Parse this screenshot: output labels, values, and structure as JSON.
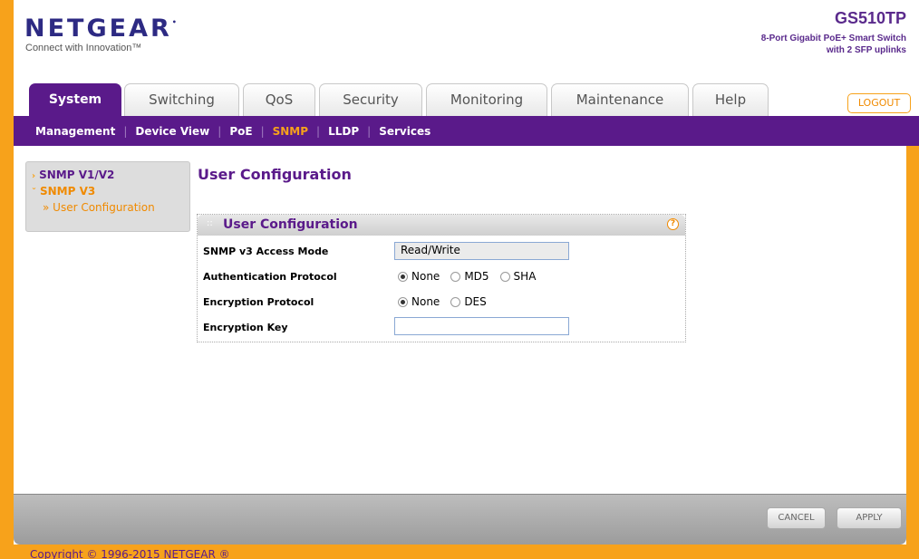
{
  "header": {
    "logo": "NETGEAR",
    "tagline": "Connect with Innovation™",
    "model": "GS510TP",
    "model_desc_line1": "8-Port Gigabit PoE+ Smart Switch",
    "model_desc_line2": "with 2 SFP uplinks",
    "logout_label": "LOGOUT"
  },
  "tabs": [
    {
      "label": "System"
    },
    {
      "label": "Switching"
    },
    {
      "label": "QoS"
    },
    {
      "label": "Security"
    },
    {
      "label": "Monitoring"
    },
    {
      "label": "Maintenance"
    },
    {
      "label": "Help"
    }
  ],
  "subnav": {
    "items": [
      {
        "label": "Management"
      },
      {
        "label": "Device View"
      },
      {
        "label": "PoE"
      },
      {
        "label": "SNMP"
      },
      {
        "label": "LLDP"
      },
      {
        "label": "Services"
      }
    ],
    "active": "SNMP"
  },
  "sidebar": {
    "items": [
      {
        "label": "SNMP V1/V2"
      },
      {
        "label": "SNMP V3"
      }
    ],
    "sub_items": [
      {
        "label": "User Configuration"
      }
    ]
  },
  "main": {
    "page_title": "User Configuration",
    "box_title": "User Configuration",
    "access_mode_label": "SNMP v3 Access Mode",
    "access_mode_value": "Read/Write",
    "auth_label": "Authentication Protocol",
    "auth_options": [
      "None",
      "MD5",
      "SHA"
    ],
    "auth_selected": "None",
    "enc_label": "Encryption Protocol",
    "enc_options": [
      "None",
      "DES"
    ],
    "enc_selected": "None",
    "enc_key_label": "Encryption Key",
    "enc_key_value": ""
  },
  "footer": {
    "cancel_label": "CANCEL",
    "apply_label": "APPLY",
    "copyright": "Copyright © 1996-2015 NETGEAR ®"
  },
  "colors": {
    "brand_purple": "#5a1a8a",
    "accent_orange": "#f7a21b"
  }
}
